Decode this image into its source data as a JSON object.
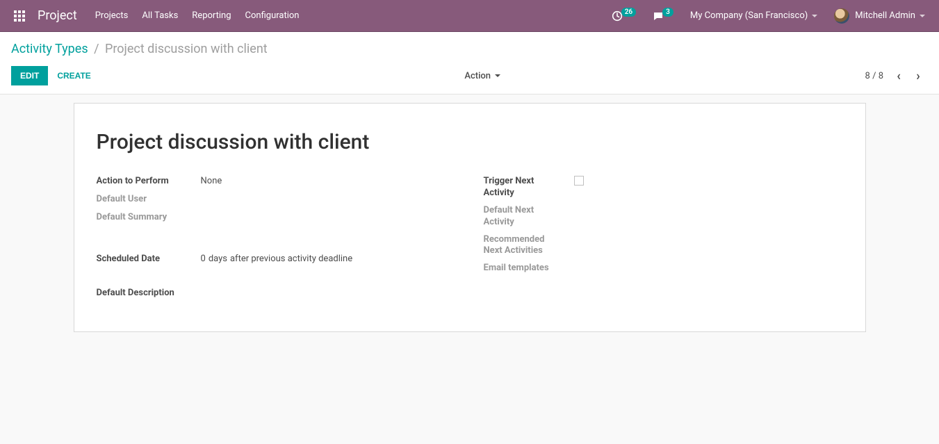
{
  "nav": {
    "brand": "Project",
    "menu": [
      "Projects",
      "All Tasks",
      "Reporting",
      "Configuration"
    ],
    "activities_count": "26",
    "messages_count": "3",
    "company": "My Company (San Francisco)",
    "user": "Mitchell Admin"
  },
  "breadcrumb": {
    "parent": "Activity Types",
    "current": "Project discussion with client"
  },
  "cp": {
    "edit": "Edit",
    "create": "Create",
    "action": "Action",
    "pager_current": "8",
    "pager_total": "8",
    "pager_sep": " / "
  },
  "form": {
    "title": "Project discussion with client",
    "labels": {
      "action_to_perform": "Action to Perform",
      "default_user": "Default User",
      "default_summary": "Default Summary",
      "trigger_next": "Trigger Next Activity",
      "default_next": "Default Next Activity",
      "recommended_next": "Recommended Next Activities",
      "email_templates": "Email templates",
      "scheduled_date": "Scheduled Date",
      "default_description": "Default Description"
    },
    "values": {
      "action_to_perform": "None",
      "scheduled_number": "0",
      "scheduled_unit": "days",
      "scheduled_suffix": "after previous activity deadline",
      "trigger_next_checked": false
    }
  }
}
